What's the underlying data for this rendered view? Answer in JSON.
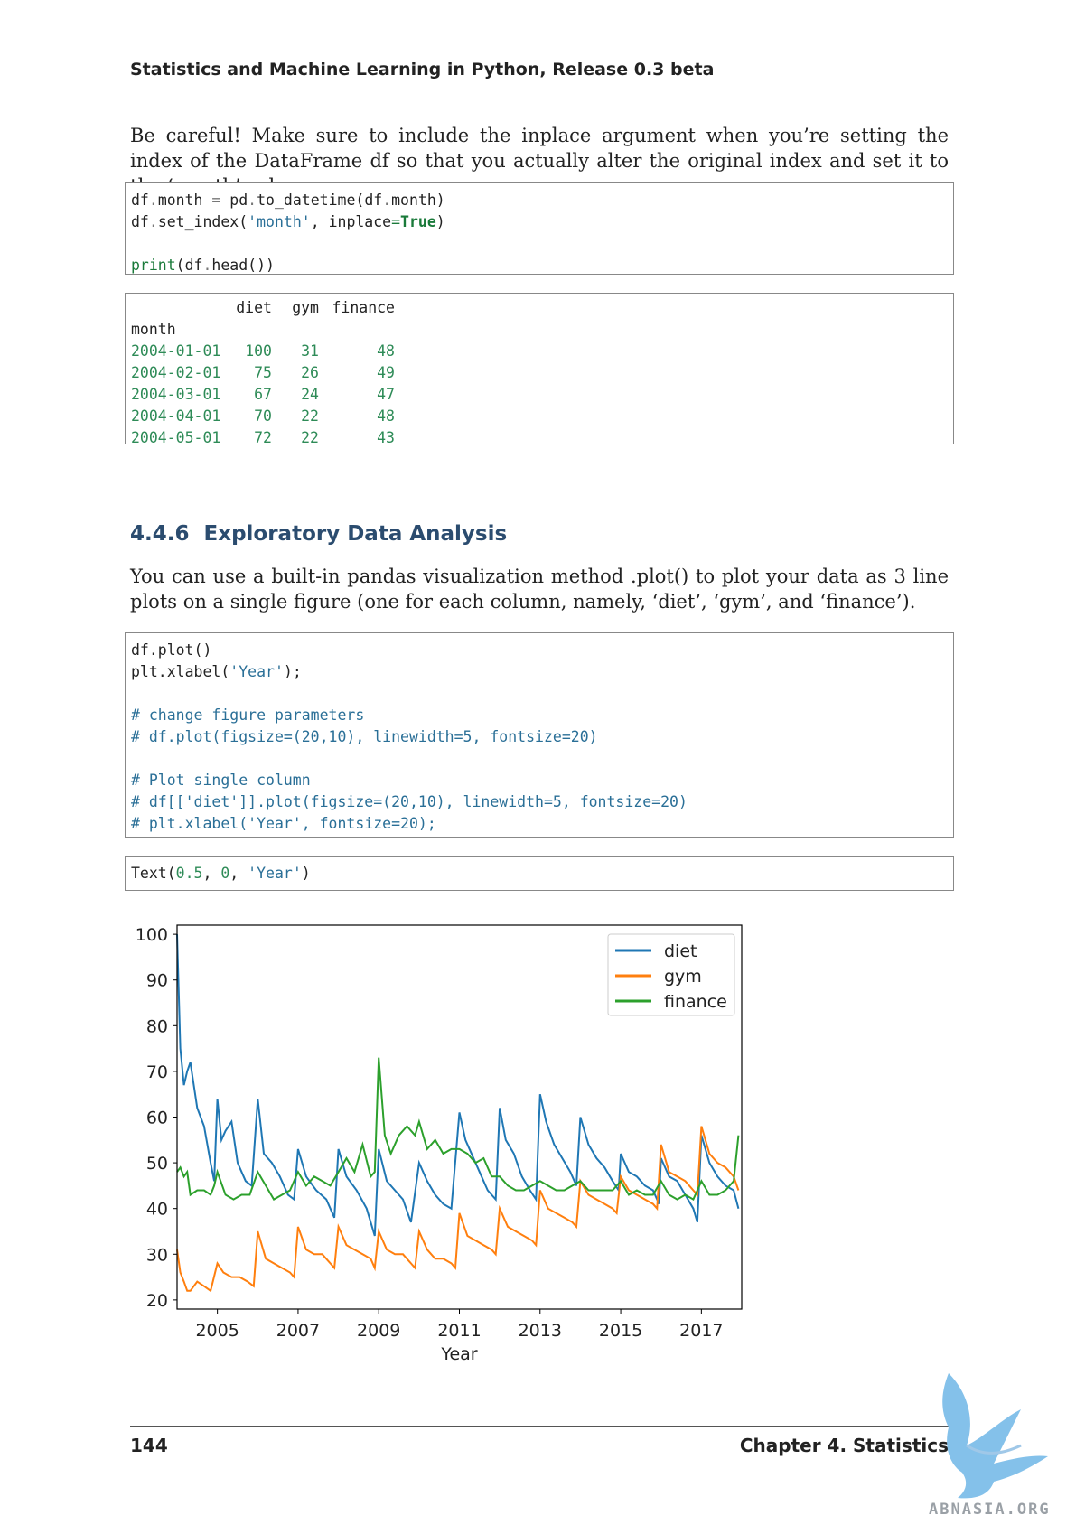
{
  "header": {
    "title": "Statistics and Machine Learning in Python, Release 0.3 beta"
  },
  "intro": {
    "text": "Be careful! Make sure to include the inplace argument when you’re setting the index of the DataFrame df so that you actually alter the original index and set it to the ‘month’ column."
  },
  "code1": {
    "l1_a": "df",
    "l1_b": ".",
    "l1_c": "month ",
    "l1_d": "=",
    "l1_e": " pd",
    "l1_f": ".",
    "l1_g": "to_datetime(df",
    "l1_h": ".",
    "l1_i": "month)",
    "l2_a": "df",
    "l2_b": ".",
    "l2_c": "set_index(",
    "l2_d": "'month'",
    "l2_e": ", inplace",
    "l2_f": "=",
    "l2_g": "True",
    "l2_h": ")",
    "l4_a": "print",
    "l4_b": "(df",
    "l4_c": ".",
    "l4_d": "head())"
  },
  "output1": {
    "columns": [
      "diet",
      "gym",
      "finance"
    ],
    "index_name": "month",
    "rows": [
      {
        "month": "2004-01-01",
        "diet": "100",
        "gym": "31",
        "finance": "48"
      },
      {
        "month": "2004-02-01",
        "diet": "75",
        "gym": "26",
        "finance": "49"
      },
      {
        "month": "2004-03-01",
        "diet": "67",
        "gym": "24",
        "finance": "47"
      },
      {
        "month": "2004-04-01",
        "diet": "70",
        "gym": "22",
        "finance": "48"
      },
      {
        "month": "2004-05-01",
        "diet": "72",
        "gym": "22",
        "finance": "43"
      }
    ]
  },
  "section": {
    "number": "4.4.6",
    "title": "Exploratory Data Analysis"
  },
  "para2": {
    "text": "You can use a built-in pandas visualization method .plot() to plot your data as 3 line plots on a single figure (one for each column, namely, ‘diet’, ‘gym’, and ‘finance’)."
  },
  "code2": {
    "l1": "df.plot()",
    "l2_a": "plt.xlabel(",
    "l2_b": "'Year'",
    "l2_c": ");",
    "c1": "# change figure parameters",
    "c2": "# df.plot(figsize=(20,10), linewidth=5, fontsize=20)",
    "c3": "# Plot single column",
    "c4": "# df[['diet']].plot(figsize=(20,10), linewidth=5, fontsize=20)",
    "c5": "# plt.xlabel('Year', fontsize=20);"
  },
  "output2": {
    "a": "Text(",
    "b": "0.5",
    "c": ", ",
    "d": "0",
    "e": ", ",
    "f": "'Year'",
    "g": ")"
  },
  "chart_data": {
    "type": "line",
    "xlabel": "Year",
    "ylabel": "",
    "xlim": [
      2004.0,
      2018.0
    ],
    "ylim": [
      18,
      102
    ],
    "xticks": [
      "2005",
      "2007",
      "2009",
      "2011",
      "2013",
      "2015",
      "2017"
    ],
    "yticks": [
      "20",
      "30",
      "40",
      "50",
      "60",
      "70",
      "80",
      "90",
      "100"
    ],
    "legend_position": "top-right",
    "series": [
      {
        "name": "diet",
        "color": "#1f77b4",
        "points": [
          [
            2004.0,
            100
          ],
          [
            2004.08,
            75
          ],
          [
            2004.17,
            67
          ],
          [
            2004.25,
            70
          ],
          [
            2004.33,
            72
          ],
          [
            2004.5,
            62
          ],
          [
            2004.67,
            58
          ],
          [
            2004.83,
            50
          ],
          [
            2004.92,
            46
          ],
          [
            2005.0,
            64
          ],
          [
            2005.1,
            55
          ],
          [
            2005.2,
            57
          ],
          [
            2005.35,
            59
          ],
          [
            2005.5,
            50
          ],
          [
            2005.7,
            46
          ],
          [
            2005.85,
            45
          ],
          [
            2006.0,
            64
          ],
          [
            2006.15,
            52
          ],
          [
            2006.35,
            50
          ],
          [
            2006.55,
            47
          ],
          [
            2006.75,
            43
          ],
          [
            2006.9,
            42
          ],
          [
            2007.0,
            53
          ],
          [
            2007.2,
            47
          ],
          [
            2007.45,
            44
          ],
          [
            2007.7,
            42
          ],
          [
            2007.9,
            38
          ],
          [
            2008.0,
            53
          ],
          [
            2008.2,
            47
          ],
          [
            2008.45,
            44
          ],
          [
            2008.7,
            40
          ],
          [
            2008.9,
            34
          ],
          [
            2009.0,
            53
          ],
          [
            2009.2,
            46
          ],
          [
            2009.4,
            44
          ],
          [
            2009.6,
            42
          ],
          [
            2009.8,
            37
          ],
          [
            2010.0,
            50
          ],
          [
            2010.2,
            46
          ],
          [
            2010.4,
            43
          ],
          [
            2010.6,
            41
          ],
          [
            2010.8,
            40
          ],
          [
            2011.0,
            61
          ],
          [
            2011.15,
            55
          ],
          [
            2011.3,
            52
          ],
          [
            2011.5,
            48
          ],
          [
            2011.7,
            44
          ],
          [
            2011.9,
            42
          ],
          [
            2012.0,
            62
          ],
          [
            2012.15,
            55
          ],
          [
            2012.35,
            52
          ],
          [
            2012.55,
            47
          ],
          [
            2012.75,
            44
          ],
          [
            2012.9,
            42
          ],
          [
            2013.0,
            65
          ],
          [
            2013.15,
            59
          ],
          [
            2013.35,
            54
          ],
          [
            2013.55,
            51
          ],
          [
            2013.75,
            48
          ],
          [
            2013.9,
            45
          ],
          [
            2014.0,
            60
          ],
          [
            2014.2,
            54
          ],
          [
            2014.4,
            51
          ],
          [
            2014.6,
            49
          ],
          [
            2014.8,
            46
          ],
          [
            2014.95,
            44
          ],
          [
            2015.0,
            52
          ],
          [
            2015.2,
            48
          ],
          [
            2015.4,
            47
          ],
          [
            2015.6,
            45
          ],
          [
            2015.8,
            44
          ],
          [
            2015.95,
            41
          ],
          [
            2016.0,
            51
          ],
          [
            2016.2,
            47
          ],
          [
            2016.4,
            46
          ],
          [
            2016.6,
            43
          ],
          [
            2016.8,
            40
          ],
          [
            2016.9,
            37
          ],
          [
            2017.0,
            56
          ],
          [
            2017.2,
            50
          ],
          [
            2017.4,
            47
          ],
          [
            2017.6,
            45
          ],
          [
            2017.8,
            44
          ],
          [
            2017.92,
            40
          ]
        ]
      },
      {
        "name": "gym",
        "color": "#ff7f0e",
        "points": [
          [
            2004.0,
            31
          ],
          [
            2004.08,
            26
          ],
          [
            2004.17,
            24
          ],
          [
            2004.25,
            22
          ],
          [
            2004.33,
            22
          ],
          [
            2004.5,
            24
          ],
          [
            2004.67,
            23
          ],
          [
            2004.83,
            22
          ],
          [
            2005.0,
            28
          ],
          [
            2005.15,
            26
          ],
          [
            2005.35,
            25
          ],
          [
            2005.55,
            25
          ],
          [
            2005.75,
            24
          ],
          [
            2005.9,
            23
          ],
          [
            2006.0,
            35
          ],
          [
            2006.2,
            29
          ],
          [
            2006.4,
            28
          ],
          [
            2006.6,
            27
          ],
          [
            2006.8,
            26
          ],
          [
            2006.9,
            25
          ],
          [
            2007.0,
            36
          ],
          [
            2007.2,
            31
          ],
          [
            2007.4,
            30
          ],
          [
            2007.6,
            30
          ],
          [
            2007.8,
            28
          ],
          [
            2007.9,
            27
          ],
          [
            2008.0,
            36
          ],
          [
            2008.2,
            32
          ],
          [
            2008.4,
            31
          ],
          [
            2008.6,
            30
          ],
          [
            2008.8,
            29
          ],
          [
            2008.9,
            27
          ],
          [
            2009.0,
            35
          ],
          [
            2009.2,
            31
          ],
          [
            2009.4,
            30
          ],
          [
            2009.6,
            30
          ],
          [
            2009.8,
            28
          ],
          [
            2009.9,
            27
          ],
          [
            2010.0,
            35
          ],
          [
            2010.2,
            31
          ],
          [
            2010.4,
            29
          ],
          [
            2010.6,
            29
          ],
          [
            2010.8,
            28
          ],
          [
            2010.9,
            27
          ],
          [
            2011.0,
            39
          ],
          [
            2011.2,
            34
          ],
          [
            2011.4,
            33
          ],
          [
            2011.6,
            32
          ],
          [
            2011.8,
            31
          ],
          [
            2011.9,
            30
          ],
          [
            2012.0,
            40
          ],
          [
            2012.2,
            36
          ],
          [
            2012.4,
            35
          ],
          [
            2012.6,
            34
          ],
          [
            2012.8,
            33
          ],
          [
            2012.9,
            32
          ],
          [
            2013.0,
            44
          ],
          [
            2013.2,
            40
          ],
          [
            2013.4,
            39
          ],
          [
            2013.6,
            38
          ],
          [
            2013.8,
            37
          ],
          [
            2013.9,
            36
          ],
          [
            2014.0,
            46
          ],
          [
            2014.2,
            43
          ],
          [
            2014.4,
            42
          ],
          [
            2014.6,
            41
          ],
          [
            2014.8,
            40
          ],
          [
            2014.9,
            39
          ],
          [
            2015.0,
            47
          ],
          [
            2015.2,
            44
          ],
          [
            2015.4,
            43
          ],
          [
            2015.6,
            42
          ],
          [
            2015.8,
            41
          ],
          [
            2015.9,
            40
          ],
          [
            2016.0,
            54
          ],
          [
            2016.2,
            48
          ],
          [
            2016.4,
            47
          ],
          [
            2016.6,
            46
          ],
          [
            2016.8,
            44
          ],
          [
            2016.9,
            43
          ],
          [
            2017.0,
            58
          ],
          [
            2017.2,
            52
          ],
          [
            2017.4,
            50
          ],
          [
            2017.6,
            49
          ],
          [
            2017.8,
            47
          ],
          [
            2017.92,
            44
          ]
        ]
      },
      {
        "name": "finance",
        "color": "#2ca02c",
        "points": [
          [
            2004.0,
            48
          ],
          [
            2004.08,
            49
          ],
          [
            2004.17,
            47
          ],
          [
            2004.25,
            48
          ],
          [
            2004.33,
            43
          ],
          [
            2004.5,
            44
          ],
          [
            2004.67,
            44
          ],
          [
            2004.83,
            43
          ],
          [
            2004.92,
            45
          ],
          [
            2005.0,
            48
          ],
          [
            2005.2,
            43
          ],
          [
            2005.4,
            42
          ],
          [
            2005.6,
            43
          ],
          [
            2005.8,
            43
          ],
          [
            2006.0,
            48
          ],
          [
            2006.2,
            45
          ],
          [
            2006.4,
            42
          ],
          [
            2006.6,
            43
          ],
          [
            2006.8,
            44
          ],
          [
            2007.0,
            48
          ],
          [
            2007.2,
            45
          ],
          [
            2007.4,
            47
          ],
          [
            2007.6,
            46
          ],
          [
            2007.8,
            45
          ],
          [
            2008.0,
            48
          ],
          [
            2008.2,
            51
          ],
          [
            2008.4,
            48
          ],
          [
            2008.6,
            54
          ],
          [
            2008.8,
            47
          ],
          [
            2008.9,
            48
          ],
          [
            2009.0,
            73
          ],
          [
            2009.15,
            56
          ],
          [
            2009.3,
            52
          ],
          [
            2009.5,
            56
          ],
          [
            2009.7,
            58
          ],
          [
            2009.9,
            56
          ],
          [
            2010.0,
            59
          ],
          [
            2010.2,
            53
          ],
          [
            2010.4,
            55
          ],
          [
            2010.6,
            52
          ],
          [
            2010.8,
            53
          ],
          [
            2011.0,
            53
          ],
          [
            2011.2,
            52
          ],
          [
            2011.4,
            50
          ],
          [
            2011.6,
            51
          ],
          [
            2011.8,
            47
          ],
          [
            2012.0,
            47
          ],
          [
            2012.2,
            45
          ],
          [
            2012.4,
            44
          ],
          [
            2012.6,
            44
          ],
          [
            2012.8,
            45
          ],
          [
            2013.0,
            46
          ],
          [
            2013.2,
            45
          ],
          [
            2013.4,
            44
          ],
          [
            2013.6,
            44
          ],
          [
            2013.8,
            45
          ],
          [
            2014.0,
            46
          ],
          [
            2014.2,
            44
          ],
          [
            2014.4,
            44
          ],
          [
            2014.6,
            44
          ],
          [
            2014.8,
            44
          ],
          [
            2015.0,
            46
          ],
          [
            2015.2,
            43
          ],
          [
            2015.4,
            44
          ],
          [
            2015.6,
            43
          ],
          [
            2015.8,
            43
          ],
          [
            2016.0,
            46
          ],
          [
            2016.2,
            43
          ],
          [
            2016.4,
            42
          ],
          [
            2016.6,
            43
          ],
          [
            2016.8,
            42
          ],
          [
            2017.0,
            46
          ],
          [
            2017.2,
            43
          ],
          [
            2017.4,
            43
          ],
          [
            2017.6,
            44
          ],
          [
            2017.8,
            46
          ],
          [
            2017.92,
            56
          ]
        ]
      }
    ]
  },
  "footer": {
    "page": "144",
    "chapter": "Chapter 4.  Statistics"
  },
  "watermark": {
    "text": "ABNASIA.ORG"
  }
}
